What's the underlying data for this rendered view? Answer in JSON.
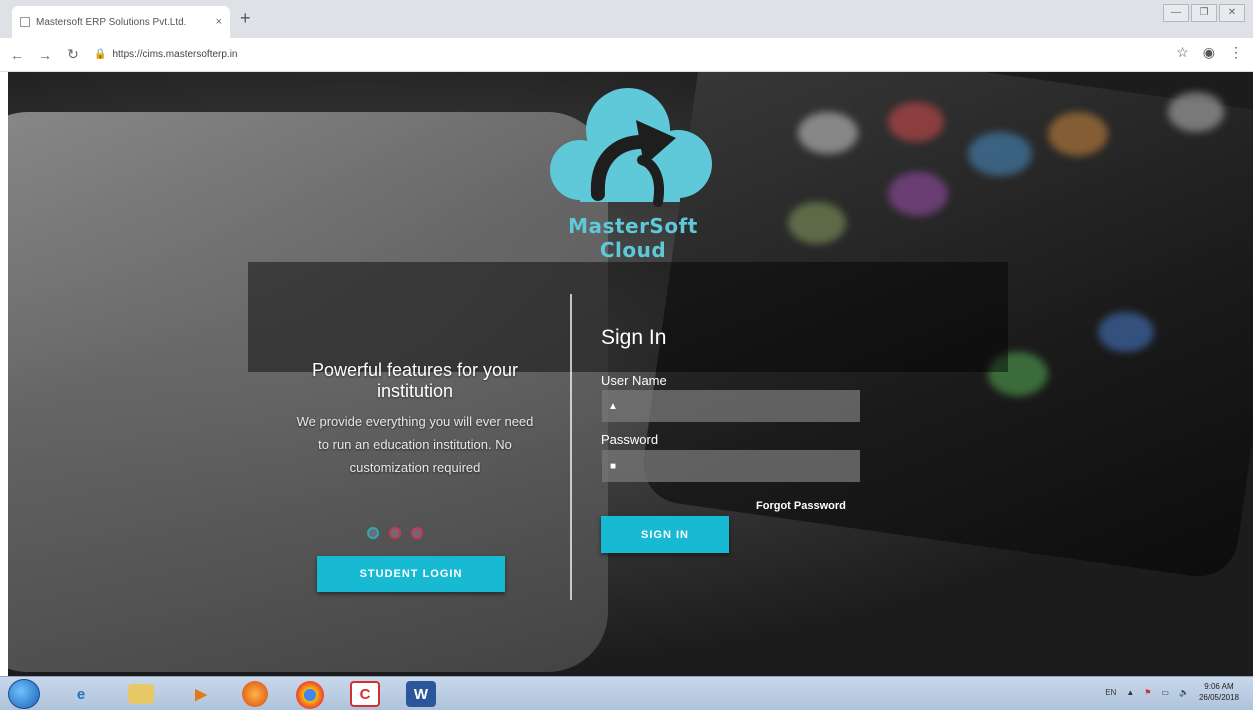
{
  "browser": {
    "tab_title": "Mastersoft ERP Solutions Pvt.Ltd.",
    "tab_close": "×",
    "new_tab": "+",
    "url": "https://cims.mastersofterp.in",
    "window_controls": [
      "▭",
      "🗗",
      "✕"
    ]
  },
  "logo": {
    "text": "MasterSoft Cloud",
    "color": "#5fc9d9"
  },
  "features": {
    "title": "Powerful features for your institution",
    "description": "We provide everything you will ever need to run an education institution. No customization required",
    "slide_count": 3,
    "active_slide": 1,
    "student_login_label": "STUDENT LOGIN"
  },
  "signin": {
    "title": "Sign In",
    "username_label": "User Name",
    "username_value": "",
    "password_label": "Password",
    "password_value": "",
    "forgot_label": "Forgot Password",
    "submit_label": "SIGN IN"
  },
  "colors": {
    "accent": "#17b9d3",
    "dot_inactive": "#c9365d",
    "dot_active": "#2aa9c0"
  },
  "taskbar": {
    "apps": [
      "start",
      "ie",
      "explorer",
      "media-player",
      "firefox",
      "chrome",
      "c-app",
      "word"
    ],
    "tray_lang": "EN",
    "time": "9:06 AM",
    "date": "26/05/2018"
  }
}
